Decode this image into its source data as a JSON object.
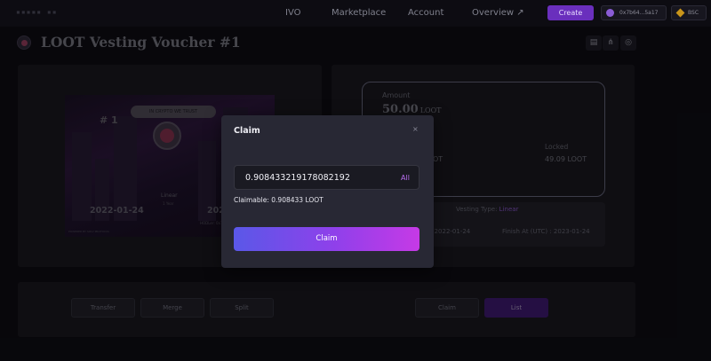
{
  "header": {
    "nav": [
      {
        "label": "IVO"
      },
      {
        "label": "Marketplace"
      },
      {
        "label": "Account"
      },
      {
        "label": "Overview ↗"
      }
    ],
    "create_label": "Create",
    "wallet_label": "0x7b64...5a17",
    "chain_label": "BSC"
  },
  "page": {
    "title": "LOOT Vesting Voucher #1",
    "tool_icons": [
      "document-icon",
      "share-icon",
      "blockchain-icon"
    ]
  },
  "voucher": {
    "number": "# 1",
    "banner": "IN CRYPTO WE TRUST",
    "type": "Linear",
    "duration": "1 Year",
    "start_date": "2022-01-24",
    "end_date_fragment": "202",
    "powered_by": "POWERED BY SOLV PROTOCOL",
    "hodler": "HODLer: 0x7B64D9285A796f4A6DCc0441b8a501f3"
  },
  "details": {
    "amount_label": "Amount",
    "amount_value": "50.00",
    "amount_unit": "LOOT",
    "unlocked_value_fragment": "OT",
    "locked_label": "Locked",
    "locked_value": "49.09 LOOT",
    "vesting_type_label": "Vesting Type:",
    "vesting_type_value": "Linear",
    "start_fragment": ": 2022-01-24",
    "finish": "Finish At (UTC) : 2023-01-24"
  },
  "actions": {
    "transfer": "Transfer",
    "merge": "Merge",
    "split": "Split",
    "claim": "Claim",
    "list": "List"
  },
  "modal": {
    "title": "Claim",
    "close": "×",
    "input_value": "0.908433219178082192",
    "all_label": "All",
    "claimable": "Claimable: 0.908433 LOOT",
    "claim_button": "Claim"
  },
  "colors": {
    "accent": "#6a2fbd",
    "claim_gradient_start": "#5a58e8",
    "claim_gradient_end": "#c63ae6",
    "background": "#0d0c12"
  }
}
